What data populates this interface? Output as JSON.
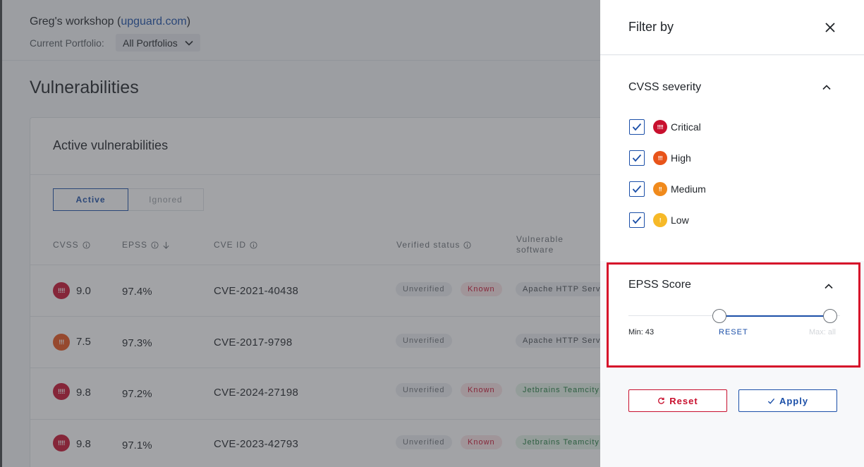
{
  "header": {
    "workshop_prefix": "Greg's workshop (",
    "workshop_domain": "upguard.com",
    "workshop_suffix": ")",
    "portfolio_label": "Current Portfolio:",
    "portfolio_value": "All Portfolios"
  },
  "page_title": "Vulnerabilities",
  "card": {
    "title": "Active vulnerabilities",
    "tabs": [
      "Active",
      "Ignored"
    ],
    "columns": {
      "cvss": "CVSS",
      "epss": "EPSS",
      "cve_id": "CVE ID",
      "verified_status": "Verified status",
      "vulnerable_software_1": "Vulnerable",
      "vulnerable_software_2": "software"
    },
    "rows": [
      {
        "severity_icon": "!!!!",
        "severity": "critical",
        "cvss": "9.0",
        "epss": "97.4%",
        "cve": "CVE-2021-40438",
        "status": "Unverified",
        "known": "Known",
        "software": "Apache HTTP Serv"
      },
      {
        "severity_icon": "!!!",
        "severity": "high",
        "cvss": "7.5",
        "epss": "97.3%",
        "cve": "CVE-2017-9798",
        "status": "Unverified",
        "known": "",
        "software": "Apache HTTP Serv"
      },
      {
        "severity_icon": "!!!!",
        "severity": "critical",
        "cvss": "9.8",
        "epss": "97.2%",
        "cve": "CVE-2024-27198",
        "status": "Unverified",
        "known": "Known",
        "software": "Jetbrains Teamcity"
      },
      {
        "severity_icon": "!!!!",
        "severity": "critical",
        "cvss": "9.8",
        "epss": "97.1%",
        "cve": "CVE-2023-42793",
        "status": "Unverified",
        "known": "Known",
        "software": "Jetbrains Teamcity"
      }
    ]
  },
  "filter_panel": {
    "title": "Filter by",
    "cvss_section": {
      "title": "CVSS severity",
      "options": [
        {
          "label": "Critical",
          "icon": "!!!!",
          "checked": true
        },
        {
          "label": "High",
          "icon": "!!!",
          "checked": true
        },
        {
          "label": "Medium",
          "icon": "!!",
          "checked": true
        },
        {
          "label": "Low",
          "icon": "!",
          "checked": true
        }
      ]
    },
    "epss_section": {
      "title": "EPSS Score",
      "min_label": "Min: 43",
      "reset_label": "RESET",
      "max_label": "Max: all"
    },
    "reset_button": "Reset",
    "apply_button": "Apply"
  },
  "colors": {
    "critical": "#c8102e",
    "high": "#e8541a",
    "medium": "#f08a1c",
    "low": "#f6b928",
    "accent": "#1b4fa8",
    "highlight_border": "#d6102a"
  },
  "icons": [
    "chevron-down-icon",
    "info-icon",
    "sort-arrow-icon",
    "close-icon",
    "chevron-up-icon",
    "checkmark-icon",
    "reset-icon"
  ]
}
